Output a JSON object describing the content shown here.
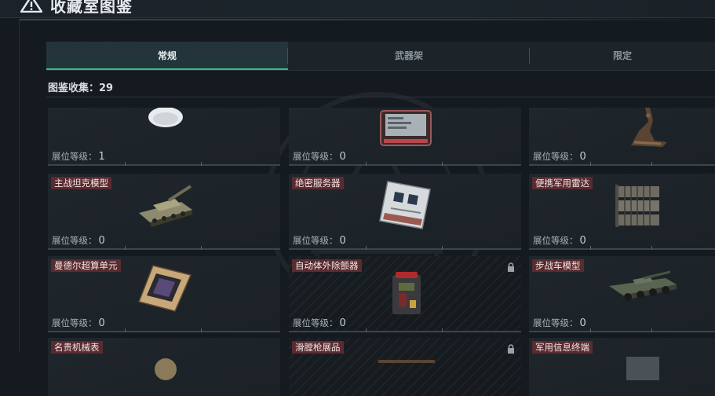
{
  "header": {
    "title": "收藏室图鉴"
  },
  "tabs": [
    {
      "label": "常规",
      "active": true
    },
    {
      "label": "武器架",
      "active": false
    },
    {
      "label": "限定",
      "active": false
    }
  ],
  "collection": {
    "count_label": "图鉴收集：29"
  },
  "level_label": "展位等级：",
  "items": [
    {
      "name": "",
      "level": "1",
      "locked": false,
      "icon": "satellite-dish-icon"
    },
    {
      "name": "",
      "level": "0",
      "locked": false,
      "icon": "tablet-device-icon"
    },
    {
      "name": "",
      "level": "0",
      "locked": false,
      "icon": "crane-hook-icon"
    },
    {
      "name": "主战坦克模型",
      "level": "0",
      "locked": false,
      "icon": "tank-model-icon"
    },
    {
      "name": "绝密服务器",
      "level": "0",
      "locked": false,
      "icon": "server-board-icon"
    },
    {
      "name": "便携军用雷达",
      "level": "0",
      "locked": false,
      "icon": "radar-panel-icon"
    },
    {
      "name": "曼德尔超算单元",
      "level": "0",
      "locked": false,
      "icon": "supercomputer-unit-icon"
    },
    {
      "name": "自动体外除颤器",
      "level": "0",
      "locked": true,
      "icon": "defibrillator-icon"
    },
    {
      "name": "步战车模型",
      "level": "0",
      "locked": false,
      "icon": "ifv-model-icon"
    },
    {
      "name": "名贵机械表",
      "level": "",
      "locked": false,
      "icon": "watch-icon"
    },
    {
      "name": "滑膛枪展品",
      "level": "",
      "locked": true,
      "icon": "musket-icon"
    },
    {
      "name": "军用信息终端",
      "level": "",
      "locked": false,
      "icon": "terminal-icon"
    }
  ],
  "colors": {
    "accent": "#3fb88e",
    "label_bg": "#5a2b2f",
    "background": "#141a1f"
  }
}
